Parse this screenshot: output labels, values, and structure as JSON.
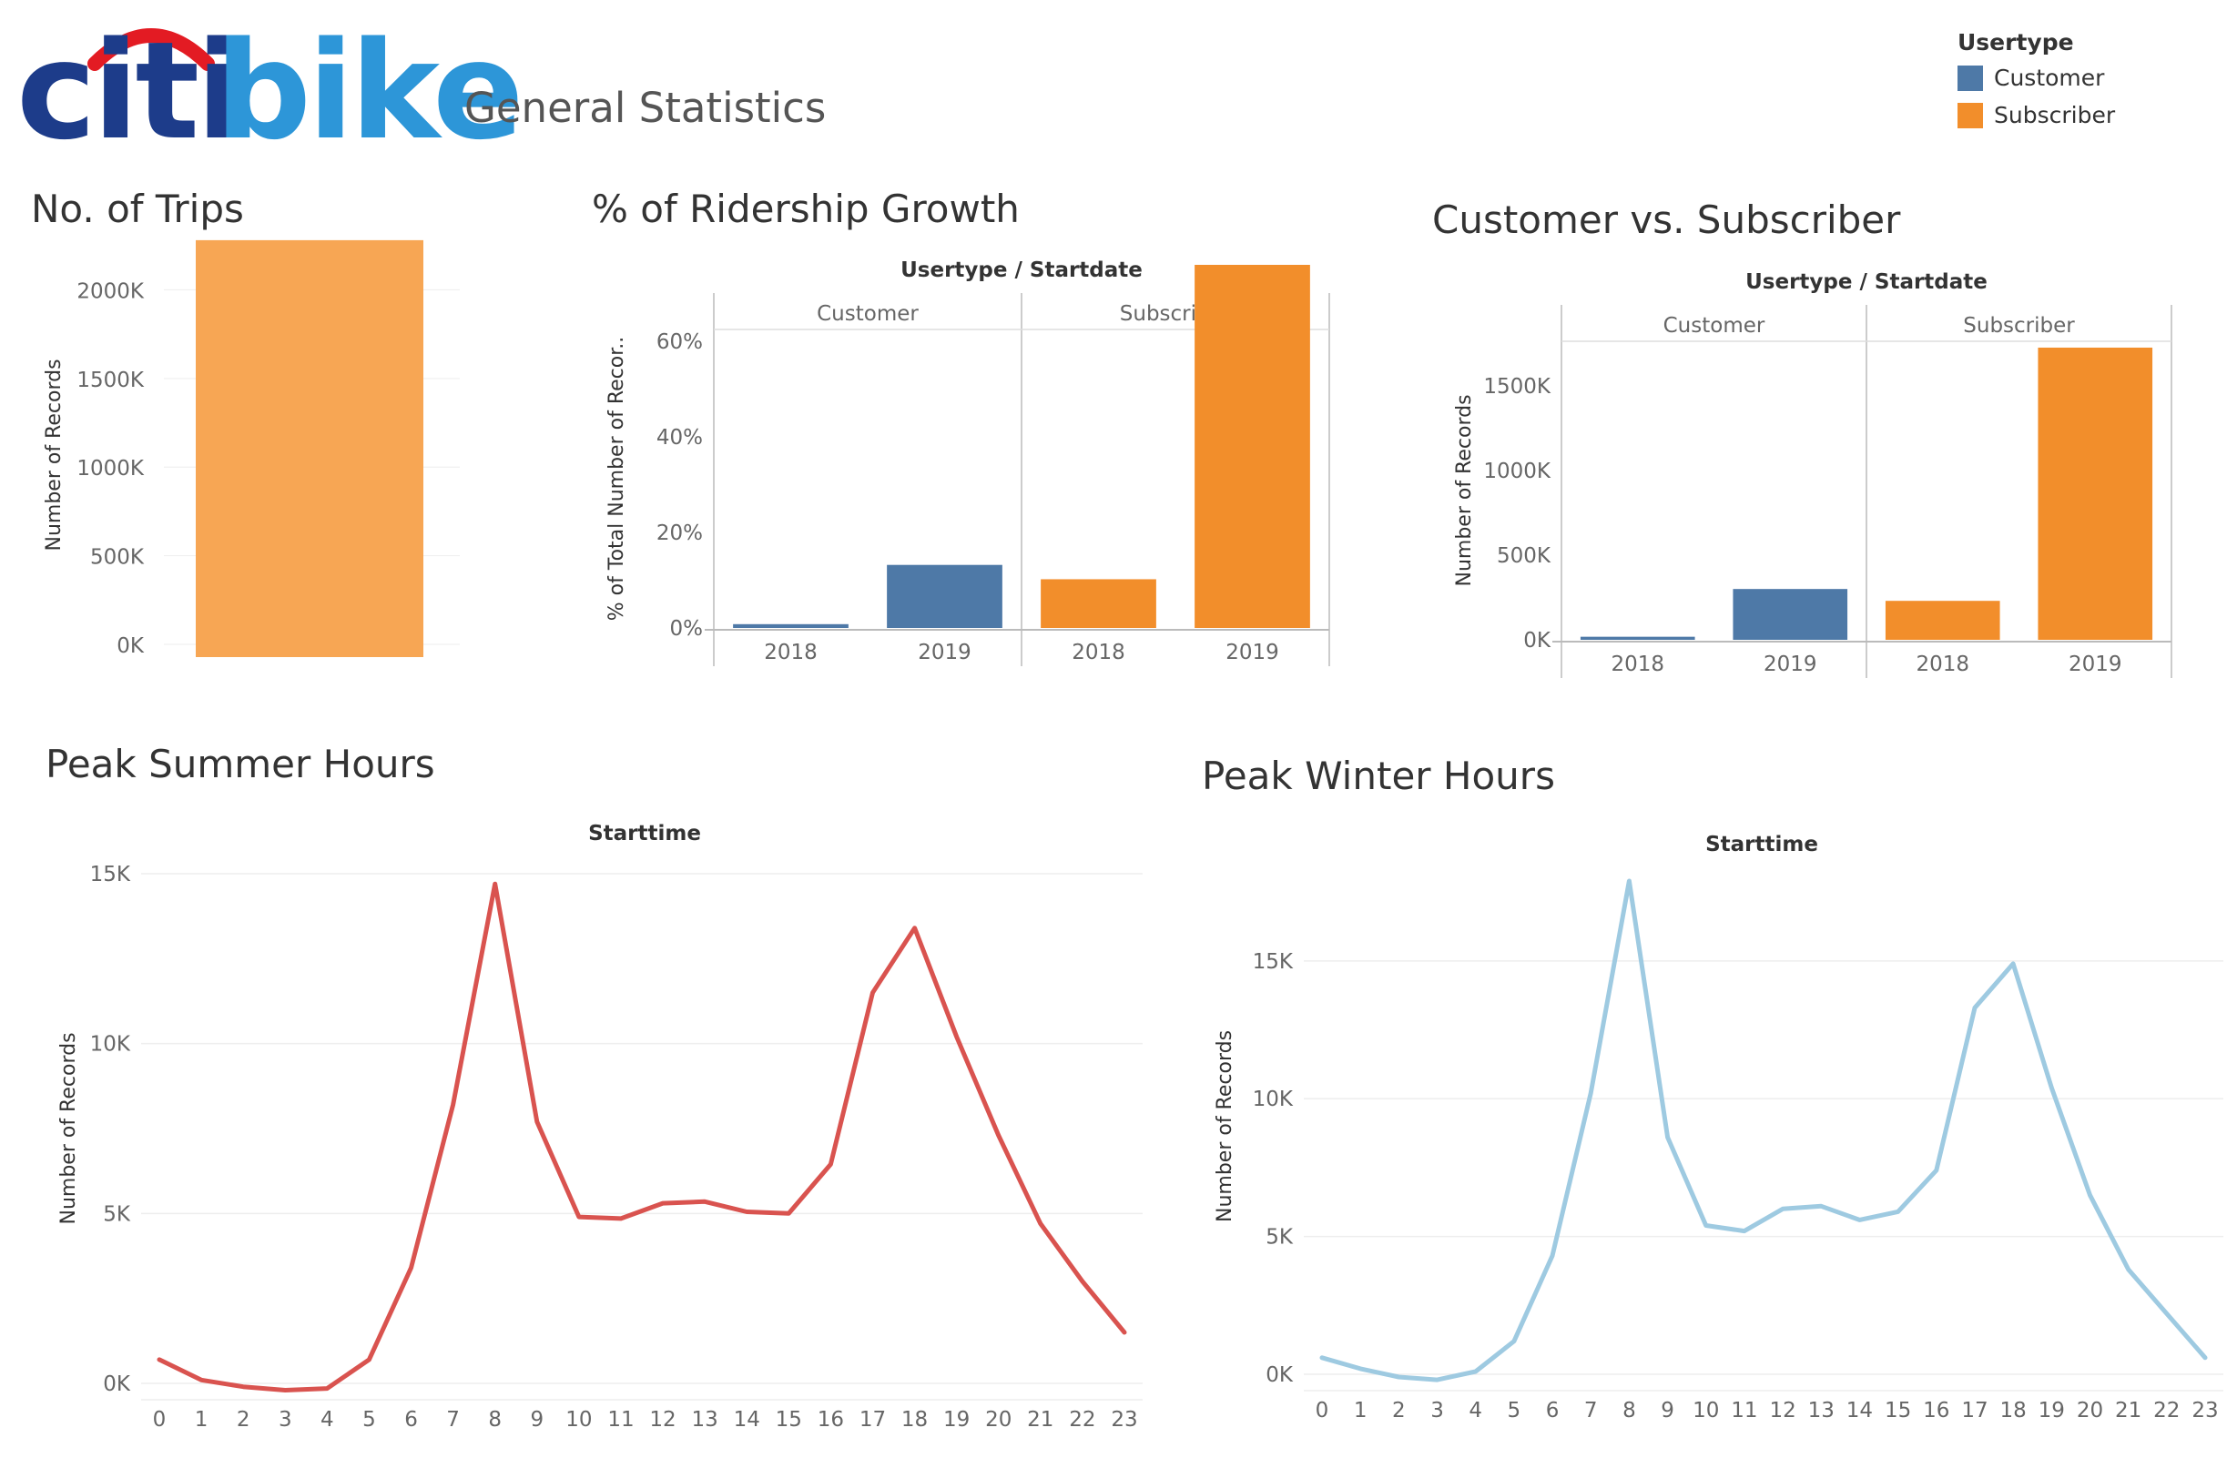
{
  "header": {
    "logo_part1": "citi",
    "logo_part2": "bike",
    "subtitle": "General Statistics"
  },
  "legend": {
    "title": "Usertype",
    "items": [
      {
        "label": "Customer",
        "color": "#4e79a7"
      },
      {
        "label": "Subscriber",
        "color": "#f28e2b"
      }
    ]
  },
  "sections": {
    "trips": "No. of Trips",
    "growth": "% of Ridership Growth",
    "cust_vs_sub": "Customer vs. Subscriber",
    "summer": "Peak Summer Hours",
    "winter": "Peak Winter Hours"
  },
  "chart_data": [
    {
      "id": "trips",
      "type": "bar",
      "title": "No. of Trips",
      "ylabel": "Number of Records",
      "values": [
        2280
      ],
      "unit": "K",
      "ylim": [
        0,
        2300
      ],
      "yticks": [
        "0K",
        "500K",
        "1000K",
        "1500K",
        "2000K"
      ],
      "color": "#f7a654"
    },
    {
      "id": "growth",
      "type": "bar",
      "title": "% of Ridership Growth",
      "header": "Usertype / Startdate",
      "ylabel": "% of Total Number of Recor..",
      "groups": [
        "Customer",
        "Subscriber"
      ],
      "categories": [
        "2018",
        "2019"
      ],
      "series": [
        {
          "name": "Customer",
          "values": [
            0.8,
            13.2
          ],
          "color": "#4e79a7"
        },
        {
          "name": "Subscriber",
          "values": [
            10.2,
            76.0
          ],
          "color": "#f28e2b"
        }
      ],
      "ylim": [
        0,
        80
      ],
      "yticks": [
        "0%",
        "20%",
        "40%",
        "60%"
      ]
    },
    {
      "id": "cust_vs_sub",
      "type": "bar",
      "title": "Customer vs. Subscriber",
      "header": "Usertype / Startdate",
      "ylabel": "Number of Records",
      "groups": [
        "Customer",
        "Subscriber"
      ],
      "categories": [
        "2018",
        "2019"
      ],
      "series": [
        {
          "name": "Customer",
          "values": [
            18,
            300
          ],
          "color": "#4e79a7"
        },
        {
          "name": "Subscriber",
          "values": [
            230,
            1725
          ],
          "color": "#f28e2b"
        }
      ],
      "ylim": [
        0,
        1800
      ],
      "yticks": [
        "0K",
        "500K",
        "1000K",
        "1500K"
      ]
    },
    {
      "id": "summer",
      "type": "line",
      "title": "Peak Summer Hours",
      "header": "Starttime",
      "ylabel": "Number of Records",
      "x": [
        0,
        1,
        2,
        3,
        4,
        5,
        6,
        7,
        8,
        9,
        10,
        11,
        12,
        13,
        14,
        15,
        16,
        17,
        18,
        19,
        20,
        21,
        22,
        23
      ],
      "values": [
        0.7,
        0.1,
        -0.1,
        -0.2,
        -0.15,
        0.7,
        3.4,
        8.2,
        14.7,
        7.7,
        4.9,
        4.85,
        5.3,
        5.35,
        5.05,
        5.0,
        6.45,
        11.5,
        13.4,
        10.2,
        7.3,
        4.7,
        3.0,
        1.5
      ],
      "ylim": [
        0,
        15
      ],
      "yticks": [
        "0K",
        "5K",
        "10K",
        "15K"
      ],
      "color": "#d9534f"
    },
    {
      "id": "winter",
      "type": "line",
      "title": "Peak Winter Hours",
      "header": "Starttime",
      "ylabel": "Number of Records",
      "x": [
        0,
        1,
        2,
        3,
        4,
        5,
        6,
        7,
        8,
        9,
        10,
        11,
        12,
        13,
        14,
        15,
        16,
        17,
        18,
        19,
        20,
        21,
        22,
        23
      ],
      "values": [
        0.6,
        0.2,
        -0.1,
        -0.2,
        0.1,
        1.2,
        4.3,
        10.2,
        17.9,
        8.6,
        5.4,
        5.2,
        6.0,
        6.1,
        5.6,
        5.9,
        7.4,
        13.3,
        14.9,
        10.4,
        6.5,
        3.8,
        2.2,
        0.6
      ],
      "ylim": [
        0,
        18
      ],
      "yticks": [
        "0K",
        "5K",
        "10K",
        "15K"
      ],
      "color": "#9ecae1"
    }
  ]
}
